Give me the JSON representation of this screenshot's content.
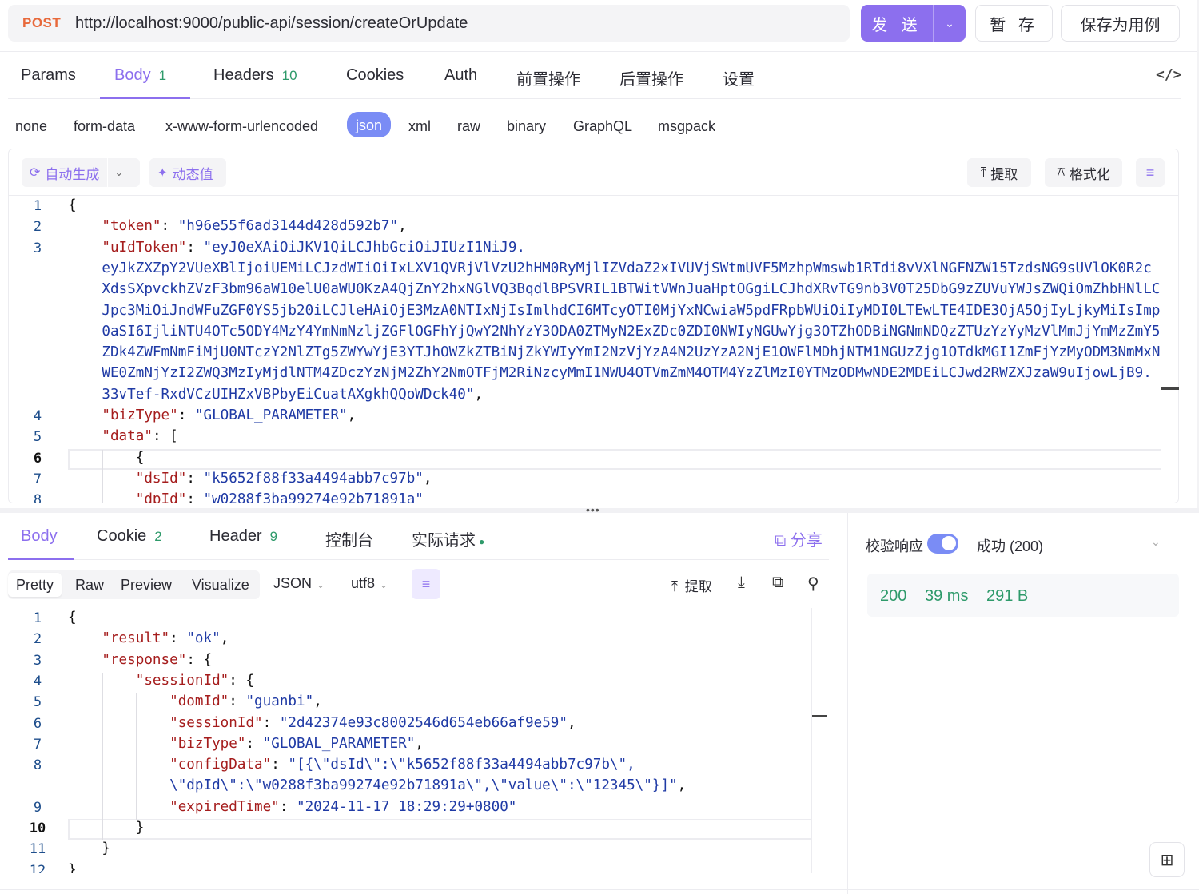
{
  "request": {
    "method": "POST",
    "url": "http://localhost:9000/public-api/session/createOrUpdate",
    "send_label": "发 送",
    "save_label": "暂 存",
    "save_as_case_label": "保存为用例"
  },
  "request_tabs": [
    {
      "label": "Params",
      "count": ""
    },
    {
      "label": "Body",
      "count": "1"
    },
    {
      "label": "Headers",
      "count": "10"
    },
    {
      "label": "Cookies",
      "count": ""
    },
    {
      "label": "Auth",
      "count": ""
    },
    {
      "label": "前置操作",
      "count": ""
    },
    {
      "label": "后置操作",
      "count": ""
    },
    {
      "label": "设置",
      "count": ""
    }
  ],
  "body_types": [
    "none",
    "form-data",
    "x-www-form-urlencoded",
    "json",
    "xml",
    "raw",
    "binary",
    "GraphQL",
    "msgpack"
  ],
  "body_type_selected": "json",
  "editor_toolbar": {
    "auto_generate": "自动生成",
    "dynamic_value": "动态值",
    "extract": "提取",
    "format": "格式化"
  },
  "request_body_lines": [
    {
      "n": "1",
      "parts": [
        [
          "p",
          "{"
        ]
      ]
    },
    {
      "n": "2",
      "parts": [
        [
          "p",
          "    "
        ],
        [
          "k",
          "\"token\""
        ],
        [
          "p",
          ": "
        ],
        [
          "s",
          "\"h96e55f6ad3144d428d592b7\""
        ],
        [
          "p",
          ","
        ]
      ]
    },
    {
      "n": "3",
      "parts": [
        [
          "p",
          "    "
        ],
        [
          "k",
          "\"uIdToken\""
        ],
        [
          "p",
          ": "
        ],
        [
          "s",
          "\"eyJ0eXAiOiJKV1QiLCJhbGciOiJIUzI1NiJ9."
        ]
      ]
    },
    {
      "n": "",
      "parts": [
        [
          "s",
          "    eyJkZXZpY2VUeXBlIjoiUEMiLCJzdWIiOiIxLXV1QVRjVlVzU2hHM0RyMjlIZVdaZ2xIVUVjSWtmUVF5MzhpWmswb1RTdi8vVXlNGFNZW15TzdsNG9sUVlOK0R2c"
        ]
      ]
    },
    {
      "n": "",
      "parts": [
        [
          "s",
          "    XdsSXpvckhZVzF3bm96aW10elU0aWU0KzA4QjZnY2hxNGlVQ3BqdlBPSVRIL1BTWitVWnJuaHptOGgiLCJhdXRvTG9nb3V0T25DbG9zZUVuYWJsZWQiOmZhbHNlLC"
        ]
      ]
    },
    {
      "n": "",
      "parts": [
        [
          "s",
          "    Jpc3MiOiJndWFuZGF0YS5jb20iLCJleHAiOjE3MzA0NTIxNjIsImlhdCI6MTcyOTI0MjYxNCwiaW5pdFRpbWUiOiIyMDI0LTEwLTE4IDE3OjA5OjIyLjkyMiIsImp"
        ]
      ]
    },
    {
      "n": "",
      "parts": [
        [
          "s",
          "    0aSI6IjliNTU4OTc5ODY4MzY4YmNmNzljZGFlOGFhYjQwY2NhYzY3ODA0ZTMyN2ExZDc0ZDI0NWIyNGUwYjg3OTZhODBiNGNmNDQzZTUzYzYyMzVlMmJjYmMzZmY5"
        ]
      ]
    },
    {
      "n": "",
      "parts": [
        [
          "s",
          "    ZDk4ZWFmNmFiMjU0NTczY2NlZTg5ZWYwYjE3YTJhOWZkZTBiNjZkYWIyYmI2NzVjYzA4N2UzYzA2NjE1OWFlMDhjNTM1NGUzZjg1OTdkMGI1ZmFjYzMyODM3NmMxN"
        ]
      ]
    },
    {
      "n": "",
      "parts": [
        [
          "s",
          "    WE0ZmNjYzI2ZWQ3MzIyMjdlNTM4ZDczYzNjM2ZhY2NmOTFjM2RiNzcyMmI1NWU4OTVmZmM4OTM4YzZlMzI0YTMzODMwNDE2MDEiLCJwd2RWZXJzaW9uIjowLjB9."
        ]
      ]
    },
    {
      "n": "",
      "parts": [
        [
          "s",
          "    33vTef-RxdVCzUIHZxVBPbyEiCuatAXgkhQQoWDck40\""
        ],
        [
          "p",
          ","
        ]
      ]
    },
    {
      "n": "4",
      "parts": [
        [
          "p",
          "    "
        ],
        [
          "k",
          "\"bizType\""
        ],
        [
          "p",
          ": "
        ],
        [
          "s",
          "\"GLOBAL_PARAMETER\""
        ],
        [
          "p",
          ","
        ]
      ]
    },
    {
      "n": "5",
      "parts": [
        [
          "p",
          "    "
        ],
        [
          "k",
          "\"data\""
        ],
        [
          "p",
          ": ["
        ]
      ]
    },
    {
      "n": "6",
      "parts": [
        [
          "p",
          "        {"
        ]
      ]
    },
    {
      "n": "7",
      "parts": [
        [
          "p",
          "        "
        ],
        [
          "k",
          "\"dsId\""
        ],
        [
          "p",
          ": "
        ],
        [
          "s",
          "\"k5652f88f33a4494abb7c97b\""
        ],
        [
          "p",
          ","
        ]
      ]
    },
    {
      "n": "8",
      "parts": [
        [
          "p",
          "        "
        ],
        [
          "k",
          "\"dpId\""
        ],
        [
          "p",
          ": "
        ],
        [
          "s",
          "\"w0288f3ba99274e92b71891a\""
        ]
      ]
    }
  ],
  "response_tabs": [
    {
      "label": "Body",
      "count": ""
    },
    {
      "label": "Cookie",
      "count": "2"
    },
    {
      "label": "Header",
      "count": "9"
    },
    {
      "label": "控制台",
      "count": ""
    },
    {
      "label": "实际请求",
      "count": ""
    }
  ],
  "share_label": "分享",
  "view_modes": [
    "Pretty",
    "Raw",
    "Preview",
    "Visualize"
  ],
  "format_select": "JSON",
  "encoding_select": "utf8",
  "response_extract": "提取",
  "response_body_lines": [
    {
      "n": "1",
      "parts": [
        [
          "p",
          "{"
        ]
      ]
    },
    {
      "n": "2",
      "parts": [
        [
          "p",
          "    "
        ],
        [
          "k",
          "\"result\""
        ],
        [
          "p",
          ": "
        ],
        [
          "s",
          "\"ok\""
        ],
        [
          "p",
          ","
        ]
      ]
    },
    {
      "n": "3",
      "parts": [
        [
          "p",
          "    "
        ],
        [
          "k",
          "\"response\""
        ],
        [
          "p",
          ": {"
        ]
      ]
    },
    {
      "n": "4",
      "parts": [
        [
          "p",
          "        "
        ],
        [
          "k",
          "\"sessionId\""
        ],
        [
          "p",
          ": {"
        ]
      ]
    },
    {
      "n": "5",
      "parts": [
        [
          "p",
          "            "
        ],
        [
          "k",
          "\"domId\""
        ],
        [
          "p",
          ": "
        ],
        [
          "s",
          "\"guanbi\""
        ],
        [
          "p",
          ","
        ]
      ]
    },
    {
      "n": "6",
      "parts": [
        [
          "p",
          "            "
        ],
        [
          "k",
          "\"sessionId\""
        ],
        [
          "p",
          ": "
        ],
        [
          "s",
          "\"2d42374e93c8002546d654eb66af9e59\""
        ],
        [
          "p",
          ","
        ]
      ]
    },
    {
      "n": "7",
      "parts": [
        [
          "p",
          "            "
        ],
        [
          "k",
          "\"bizType\""
        ],
        [
          "p",
          ": "
        ],
        [
          "s",
          "\"GLOBAL_PARAMETER\""
        ],
        [
          "p",
          ","
        ]
      ]
    },
    {
      "n": "8",
      "parts": [
        [
          "p",
          "            "
        ],
        [
          "k",
          "\"configData\""
        ],
        [
          "p",
          ": "
        ],
        [
          "s",
          "\"[{\\\"dsId\\\":\\\"k5652f88f33a4494abb7c97b\\\","
        ]
      ]
    },
    {
      "n": "",
      "parts": [
        [
          "s",
          "            \\\"dpId\\\":\\\"w0288f3ba99274e92b71891a\\\",\\\"value\\\":\\\"12345\\\"}]\""
        ],
        [
          "p",
          ","
        ]
      ]
    },
    {
      "n": "9",
      "parts": [
        [
          "p",
          "            "
        ],
        [
          "k",
          "\"expiredTime\""
        ],
        [
          "p",
          ": "
        ],
        [
          "s",
          "\"2024-11-17 18:29:29+0800\""
        ]
      ]
    },
    {
      "n": "10",
      "parts": [
        [
          "p",
          "        }"
        ]
      ]
    },
    {
      "n": "11",
      "parts": [
        [
          "p",
          "    }"
        ]
      ]
    },
    {
      "n": "12",
      "parts": [
        [
          "p",
          "}"
        ]
      ]
    }
  ],
  "validate": {
    "label": "校验响应",
    "enabled": true,
    "result": "成功 (200)"
  },
  "stats": {
    "status": "200",
    "time": "39 ms",
    "size": "291 B"
  },
  "colors": {
    "accent": "#8c6fee",
    "method": "#e8693b",
    "count_green": "#2e9a6a",
    "json_key": "#a51d1d",
    "json_string": "#1f3aa5",
    "toggle": "#7a8cf5"
  }
}
